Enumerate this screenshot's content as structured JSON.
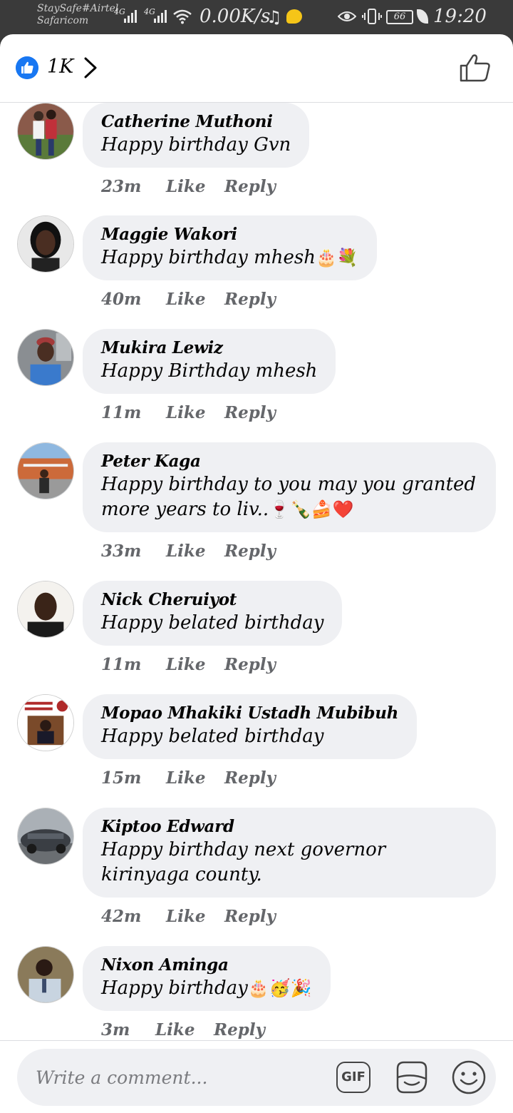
{
  "status_bar": {
    "carrier_line1": "StaySafe#Airtel",
    "carrier_line2": "Safaricom",
    "signal1": "4G",
    "signal2": "4G",
    "net_speed": "0.00K/s",
    "battery": "66",
    "time": "19:20"
  },
  "header": {
    "reaction_count": "1K"
  },
  "comments": [
    {
      "author": "Catherine Muthoni",
      "text": "Happy birthday Gvn",
      "emojis": "",
      "time": "23m"
    },
    {
      "author": "Maggie Wakori",
      "text": "Happy birthday mhesh",
      "emojis": "🎂💐",
      "time": "40m"
    },
    {
      "author": "Mukira Lewiz",
      "text": "Happy Birthday mhesh",
      "emojis": "",
      "time": "11m"
    },
    {
      "author": "Peter Kaga",
      "text": "Happy birthday to you may you granted more years to liv..",
      "emojis": "🍷🍾🍰❤️",
      "time": "33m"
    },
    {
      "author": "Nick Cheruiyot",
      "text": "Happy belated birthday",
      "emojis": "",
      "time": "11m"
    },
    {
      "author": "Mopao Mhakiki Ustadh Mubibuh",
      "text": "Happy belated birthday",
      "emojis": "",
      "time": "15m"
    },
    {
      "author": "Kiptoo Edward",
      "text": "Happy birthday next governor kirinyaga county.",
      "emojis": "",
      "time": "42m"
    },
    {
      "author": "Nixon Aminga",
      "text": "Happy birthday",
      "emojis": "🎂🥳🎉",
      "time": "3m"
    }
  ],
  "actions": {
    "like": "Like",
    "reply": "Reply"
  },
  "composer": {
    "placeholder": "Write a comment...",
    "gif_label": "GIF"
  },
  "colors": {
    "accent": "#1877f2",
    "bubble": "#eff0f3",
    "meta": "#65676b",
    "status_bar": "#3a3a3a"
  },
  "icons": {
    "like_badge": "thumbs-up-icon",
    "chevron": "chevron-right-icon",
    "header_like": "thumbs-up-outline-icon",
    "gif": "gif-icon",
    "sticker": "sticker-icon",
    "emoji": "smiley-icon"
  }
}
